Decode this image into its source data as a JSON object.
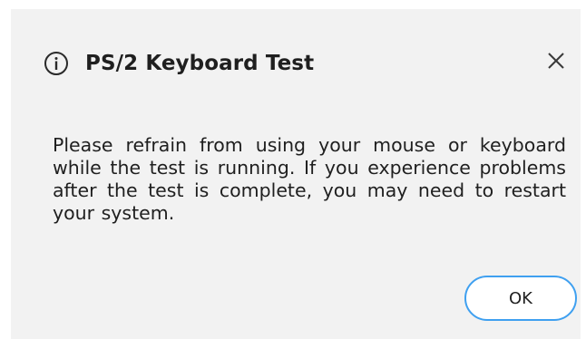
{
  "dialog": {
    "title": "PS/2 Keyboard Test",
    "title_icon": "info-icon",
    "close_icon": "close-icon",
    "message": "Please refrain from using your mouse or keyboard while the test is running. If you experience problems after the test is complete, you may need to restart your system.",
    "ok_label": "OK"
  },
  "colors": {
    "dialog_background": "#f2f2f2",
    "ok_border": "#3fa0f0",
    "text": "#1f1f1f"
  }
}
